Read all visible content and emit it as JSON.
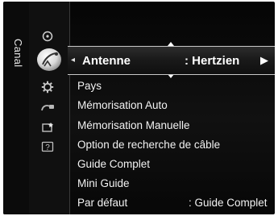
{
  "rail": {
    "label": "Canal"
  },
  "icons": [
    {
      "name": "picture-icon"
    },
    {
      "name": "antenna-icon"
    },
    {
      "name": "setup-gear-icon"
    },
    {
      "name": "input-icon"
    },
    {
      "name": "application-icon"
    },
    {
      "name": "support-icon"
    }
  ],
  "selected": {
    "label": "Antenne",
    "value": ": Hertzien",
    "left_arrow": "◂",
    "right_arrow": "▶"
  },
  "menu": {
    "items": [
      {
        "label": "Pays",
        "value": ""
      },
      {
        "label": "Mémorisation Auto",
        "value": ""
      },
      {
        "label": "Mémorisation Manuelle",
        "value": ""
      },
      {
        "label": "Option de recherche de câble",
        "value": ""
      },
      {
        "label": "Guide Complet",
        "value": ""
      },
      {
        "label": "Mini Guide",
        "value": ""
      },
      {
        "label": "Par défaut",
        "value": ": Guide Complet"
      }
    ]
  },
  "colors": {
    "background": "#0a0a0a",
    "text": "#f2f2f2",
    "highlight_border": "#c8c8c8"
  }
}
